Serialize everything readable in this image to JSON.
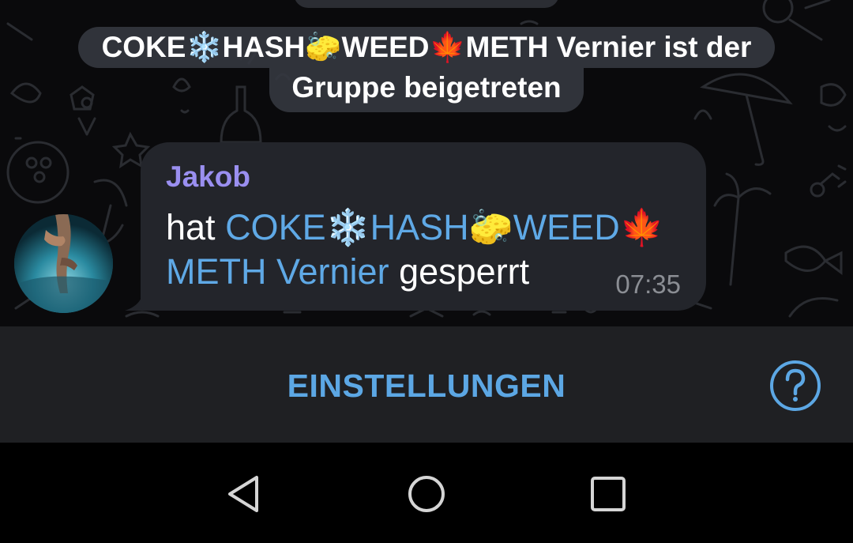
{
  "service_message": {
    "line1_parts": [
      "COKE",
      "❄️",
      "HASH",
      "🧽",
      "WEED",
      "🍁",
      "METH Vernier ist der"
    ],
    "line2": "Gruppe beigetreten"
  },
  "message": {
    "sender": "Jakob",
    "prefix": "hat ",
    "mention_parts": [
      "COKE",
      "❄️",
      "HASH",
      "🧽",
      "WEED",
      "🍁"
    ],
    "mention_line2": "METH Vernier",
    "suffix": " gesperrt",
    "time": "07:35"
  },
  "bottom_bar": {
    "settings_label": "EINSTELLUNGEN",
    "help_icon": "question-circle-icon"
  },
  "nav_bar": {
    "back_icon": "back-triangle-icon",
    "home_icon": "home-circle-icon",
    "recents_icon": "recents-square-icon"
  },
  "colors": {
    "accent": "#5ca7e4",
    "sender_name": "#9a8ff0",
    "bubble": "#23252b",
    "bar": "#1f2023"
  }
}
